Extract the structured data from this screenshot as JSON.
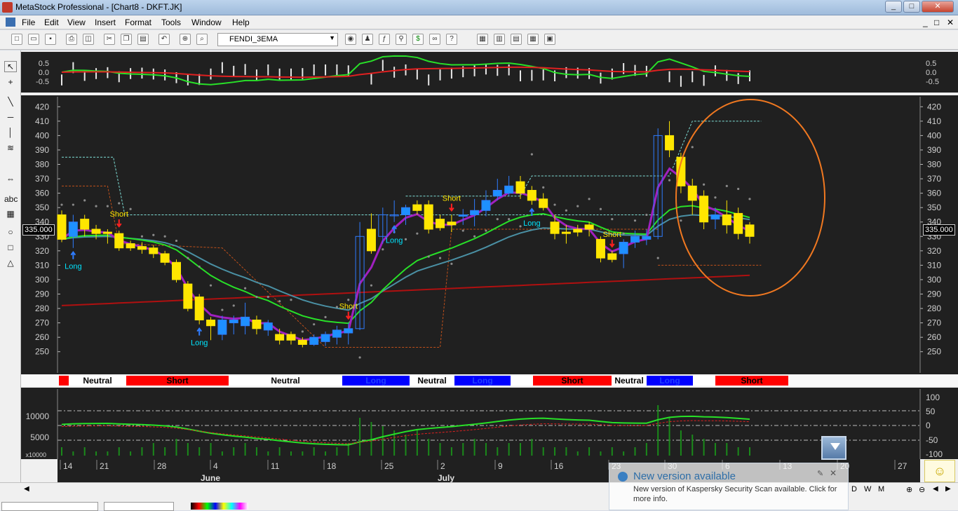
{
  "window": {
    "title": "MetaStock Professional - [Chart8 - DKFT.JK]",
    "min_label": "_",
    "max_label": "□",
    "close_label": "✕"
  },
  "menu": [
    "File",
    "Edit",
    "View",
    "Insert",
    "Format",
    "Tools",
    "Window",
    "Help"
  ],
  "mdi_controls": [
    "_",
    "□",
    "✕"
  ],
  "toolbar": {
    "template_value": "FENDI_3EMA",
    "icons": [
      "new-icon",
      "open-icon",
      "save-icon",
      "print-icon",
      "print-preview-icon",
      "cut-icon",
      "copy-icon",
      "paste-icon",
      "undo-icon",
      "crosshair-icon",
      "zoom-icon",
      "security-icon",
      "expert-icon",
      "formula-icon",
      "explorer-icon",
      "dollar-icon",
      "binoculars-icon",
      "help-icon",
      "tile-icon",
      "layout1-icon",
      "layout2-icon",
      "layout3-icon",
      "layout4-icon"
    ]
  },
  "left_tools": [
    "pointer-icon",
    "crosshair-tool-icon",
    "line-icon",
    "hline-icon",
    "vline-icon",
    "fib-icon",
    "scroll-icon",
    "text-icon",
    "grid-tool-icon",
    "ellipse-icon",
    "rect-icon",
    "triangle-icon"
  ],
  "price_label": "335.000",
  "osc_axis": [
    "0.5",
    "0.0",
    "-0.5"
  ],
  "price_axis": [
    "420",
    "410",
    "400",
    "390",
    "380",
    "370",
    "360",
    "350",
    "340",
    "330",
    "320",
    "310",
    "300",
    "290",
    "280",
    "270",
    "260",
    "250"
  ],
  "vol_axis_left": [
    "10000",
    "5000"
  ],
  "vol_axis_left_small": "x10000",
  "vol_axis_right": [
    "100",
    "50",
    "0",
    "-50",
    "-100"
  ],
  "date_ticks": [
    "14",
    "21",
    "28",
    "4",
    "11",
    "18",
    "25",
    "2",
    "9",
    "16",
    "23",
    "30",
    "6",
    "13",
    "20",
    "27"
  ],
  "months": [
    "June",
    "July"
  ],
  "status_bar": [
    {
      "label": "",
      "color": "#ff0000"
    },
    {
      "label": "Neutral",
      "color": "#ffffff"
    },
    {
      "label": "Short",
      "color": "#ff0000"
    },
    {
      "label": "Neutral",
      "color": "#ffffff"
    },
    {
      "label": "Long",
      "color": "#0000ff"
    },
    {
      "label": "Neutral",
      "color": "#ffffff"
    },
    {
      "label": "Long",
      "color": "#0000ff"
    },
    {
      "label": "",
      "color": "#ffffff"
    },
    {
      "label": "Short",
      "color": "#ff0000"
    },
    {
      "label": "Neutral",
      "color": "#ffffff"
    },
    {
      "label": "Long",
      "color": "#0000ff"
    },
    {
      "label": "",
      "color": "#ffffff"
    },
    {
      "label": "Short",
      "color": "#ff0000"
    }
  ],
  "signals": [
    {
      "text": "Long",
      "type": "long",
      "date_index": 1
    },
    {
      "text": "Short",
      "type": "short",
      "date_index": 5
    },
    {
      "text": "Long",
      "type": "long",
      "date_index": 12
    },
    {
      "text": "Short",
      "type": "short",
      "date_index": 25
    },
    {
      "text": "Long",
      "type": "long",
      "date_index": 29
    },
    {
      "text": "Short",
      "type": "short",
      "date_index": 34
    },
    {
      "text": "Long",
      "type": "long",
      "date_index": 41
    },
    {
      "text": "Short",
      "type": "short",
      "date_index": 48
    }
  ],
  "toast": {
    "title": "New version available",
    "body": "New version of Kaspersky Security Scan available. Click for more info."
  },
  "chart_data": {
    "type": "candlestick",
    "price_ylim": [
      245,
      425
    ],
    "candles": [
      [
        1,
        345,
        328,
        348,
        326
      ],
      [
        2,
        330,
        340,
        345,
        322
      ],
      [
        3,
        342,
        335,
        345,
        330
      ],
      [
        4,
        335,
        332,
        338,
        328
      ],
      [
        5,
        333,
        332,
        335,
        325
      ],
      [
        6,
        332,
        322,
        334,
        320
      ],
      [
        7,
        325,
        322,
        327,
        320
      ],
      [
        8,
        323,
        321,
        326,
        318
      ],
      [
        9,
        322,
        318,
        324,
        315
      ],
      [
        10,
        318,
        312,
        320,
        310
      ],
      [
        11,
        312,
        300,
        314,
        298
      ],
      [
        12,
        297,
        280,
        299,
        278
      ],
      [
        13,
        288,
        272,
        290,
        269
      ],
      [
        14,
        272,
        268,
        274,
        258
      ],
      [
        15,
        262,
        272,
        275,
        258
      ],
      [
        16,
        270,
        272,
        275,
        262
      ],
      [
        17,
        268,
        274,
        284,
        262
      ],
      [
        18,
        272,
        266,
        275,
        262
      ],
      [
        19,
        265,
        270,
        272,
        261
      ],
      [
        20,
        262,
        258,
        266,
        255
      ],
      [
        21,
        262,
        258,
        264,
        255
      ],
      [
        22,
        258,
        255,
        260,
        253
      ],
      [
        23,
        255,
        260,
        262,
        254
      ],
      [
        24,
        257,
        262,
        264,
        254
      ],
      [
        25,
        260,
        265,
        268,
        255
      ],
      [
        26,
        263,
        266,
        270,
        255
      ],
      [
        27,
        266,
        330,
        340,
        265
      ],
      [
        28,
        335,
        320,
        346,
        318
      ],
      [
        29,
        330,
        345,
        350,
        325
      ],
      [
        30,
        345,
        345,
        355,
        340
      ],
      [
        31,
        345,
        350,
        352,
        338
      ],
      [
        32,
        352,
        348,
        355,
        345
      ],
      [
        33,
        352,
        335,
        355,
        332
      ],
      [
        34,
        342,
        336,
        345,
        334
      ],
      [
        35,
        340,
        338,
        345,
        333
      ],
      [
        36,
        344,
        345,
        349,
        338
      ],
      [
        37,
        345,
        348,
        356,
        337
      ],
      [
        38,
        348,
        355,
        362,
        344
      ],
      [
        39,
        358,
        362,
        370,
        355
      ],
      [
        40,
        360,
        365,
        372,
        358
      ],
      [
        41,
        368,
        360,
        372,
        356
      ],
      [
        42,
        362,
        355,
        365,
        352
      ],
      [
        43,
        356,
        350,
        360,
        348
      ],
      [
        44,
        340,
        332,
        345,
        328
      ],
      [
        45,
        333,
        332,
        338,
        325
      ],
      [
        46,
        335,
        333,
        338,
        330
      ],
      [
        47,
        338,
        335,
        340,
        330
      ],
      [
        48,
        328,
        315,
        330,
        312
      ],
      [
        49,
        318,
        314,
        320,
        312
      ],
      [
        50,
        318,
        326,
        328,
        308
      ],
      [
        51,
        326,
        330,
        334,
        322
      ],
      [
        52,
        328,
        330,
        335,
        324
      ],
      [
        53,
        330,
        400,
        405,
        328
      ],
      [
        54,
        400,
        390,
        410,
        385
      ],
      [
        55,
        385,
        365,
        388,
        360
      ],
      [
        56,
        365,
        355,
        370,
        345
      ],
      [
        57,
        358,
        340,
        362,
        335
      ],
      [
        58,
        342,
        345,
        350,
        335
      ],
      [
        59,
        345,
        338,
        355,
        332
      ],
      [
        60,
        346,
        332,
        350,
        328
      ],
      [
        61,
        338,
        330,
        340,
        325
      ]
    ],
    "series": [
      {
        "name": "",
        "color": "#a020c0"
      },
      {
        "name": "",
        "color": "#28e028"
      },
      {
        "name": "",
        "color": "#4a90a4"
      },
      {
        "name": "",
        "color": "#b01010"
      }
    ],
    "volume": [
      2,
      1,
      2,
      1,
      1,
      2,
      1,
      2,
      3,
      2,
      4,
      3,
      2,
      3,
      1,
      2,
      3,
      2,
      1,
      2,
      1,
      1,
      2,
      1,
      2,
      3,
      9,
      8,
      7,
      6,
      5,
      6,
      4,
      3,
      2,
      3,
      4,
      3,
      2,
      3,
      3,
      4,
      2,
      2,
      2,
      1,
      2,
      1,
      2,
      1,
      2,
      3,
      12,
      9,
      6,
      5,
      4,
      3,
      3,
      2,
      2
    ]
  }
}
